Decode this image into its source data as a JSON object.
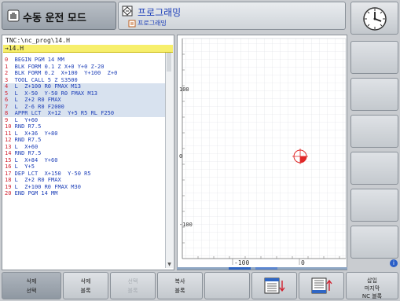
{
  "header": {
    "mode_label": "수동 운전 모드",
    "prog_label": "프로그래밍",
    "prog_sub_label": "프로그래밍"
  },
  "program": {
    "path": "TNC:\\nc_prog\\14.H",
    "file": "→14.H",
    "lines": [
      {
        "n": "0",
        "t": "  BEGIN PGM 14 MM",
        "hl": false
      },
      {
        "n": "1",
        "t": "  BLK FORM 0.1 Z X+0 Y+0 Z-20",
        "hl": false
      },
      {
        "n": "2",
        "t": "  BLK FORM 0.2  X+100  Y+100  Z+0",
        "hl": false
      },
      {
        "n": "3",
        "t": "  TOOL CALL 5 Z S3500",
        "hl": false
      },
      {
        "n": "4",
        "t": "  L  Z+100 R0 FMAX M13",
        "hl": true
      },
      {
        "n": "5",
        "t": "  L  X-50  Y-50 R0 FMAX M13",
        "hl": true
      },
      {
        "n": "6",
        "t": "  L  Z+2 R0 FMAX",
        "hl": true
      },
      {
        "n": "7",
        "t": "  L  Z-6 R0 F2000",
        "hl": true
      },
      {
        "n": "8",
        "t": "  APPR LCT  X+12  Y+5 R5 RL F250",
        "hl": true
      },
      {
        "n": "9",
        "t": "  L  Y+60",
        "hl": false
      },
      {
        "n": "10",
        "t": " RND R7.5",
        "hl": false
      },
      {
        "n": "11",
        "t": " L  X+36  Y+80",
        "hl": false
      },
      {
        "n": "12",
        "t": " RND R7.5",
        "hl": false
      },
      {
        "n": "13",
        "t": " L  X+60",
        "hl": false
      },
      {
        "n": "14",
        "t": " RND R7.5",
        "hl": false
      },
      {
        "n": "15",
        "t": " L  X+84  Y+60",
        "hl": false
      },
      {
        "n": "16",
        "t": " L  Y+5",
        "hl": false
      },
      {
        "n": "17",
        "t": " DEP LCT  X+150  Y-50 R5",
        "hl": false
      },
      {
        "n": "18",
        "t": " L  Z+2 R0 FMAX",
        "hl": false
      },
      {
        "n": "19",
        "t": " L  Z+100 R0 FMAX M30",
        "hl": false
      },
      {
        "n": "20",
        "t": " END PGM 14 MM",
        "hl": false
      }
    ]
  },
  "graphic": {
    "x_tick_left": "-100",
    "x_tick_right": "0",
    "y_tick_top": "100",
    "y_tick_mid": "0",
    "y_tick_bottom": "-100"
  },
  "softkeys": {
    "k1_l1": "삭제",
    "k1_l2": "선택",
    "k2_l1": "삭제",
    "k2_l2": "블록",
    "k3_l1": "선택",
    "k3_l2": "블록",
    "k4_l1": "복사",
    "k4_l2": "블록",
    "k8_l1": "삽입",
    "k8_l2": "마지막",
    "k8_l3": "NC 블록"
  },
  "colors": {
    "accent": "#2f66c4",
    "line_number": "#d1202e",
    "nc_text": "#1d3fb8",
    "file_bar": "#f7ef6c"
  }
}
